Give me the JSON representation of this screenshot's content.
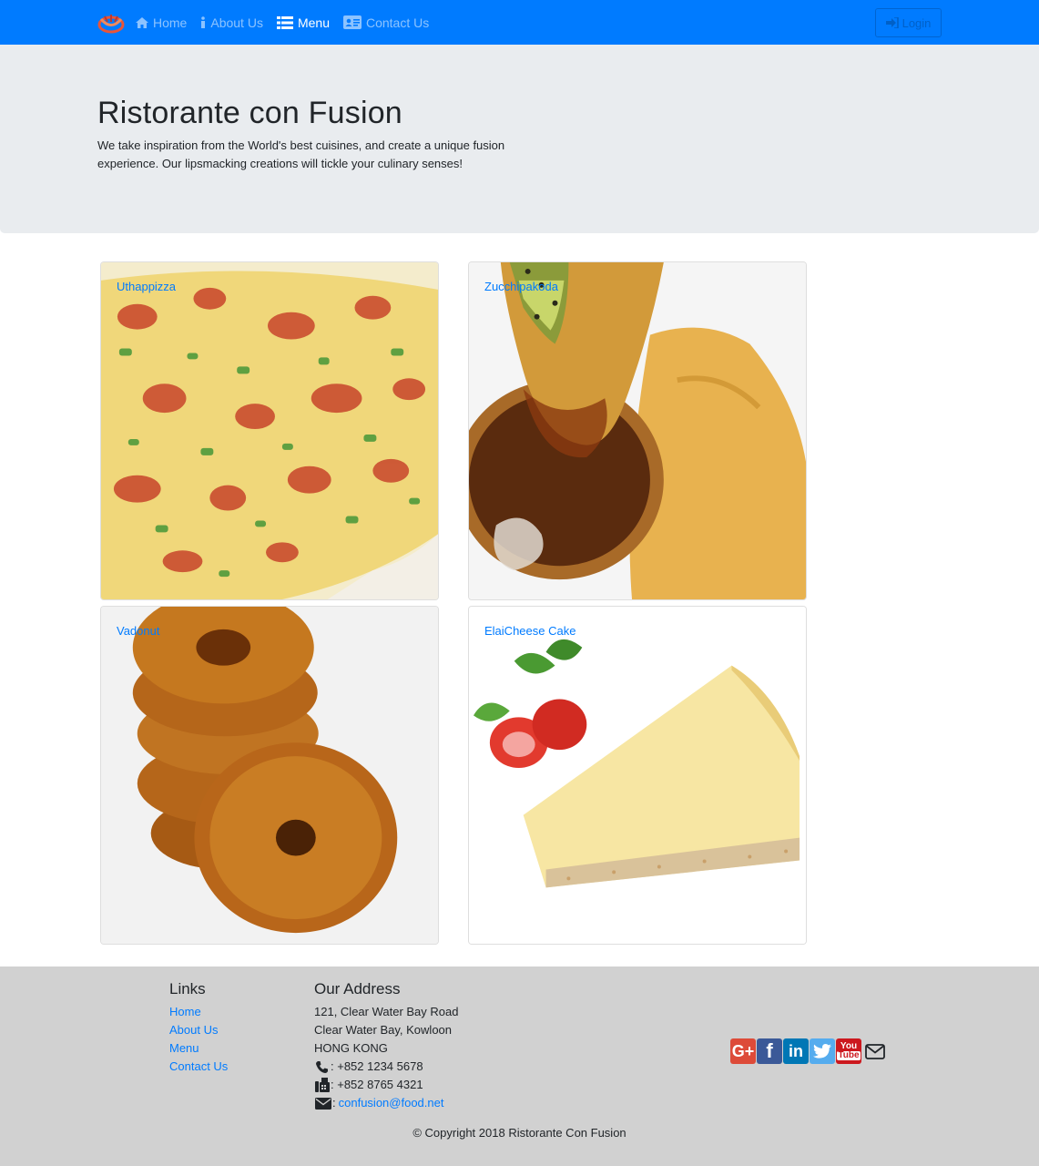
{
  "navbar": {
    "brand_icon": "restaurant-logo-icon",
    "items": [
      {
        "label": "Home",
        "icon": "home-icon"
      },
      {
        "label": "About Us",
        "icon": "info-icon"
      },
      {
        "label": "Menu",
        "icon": "list-icon",
        "active": true
      },
      {
        "label": "Contact Us",
        "icon": "address-card-icon"
      }
    ],
    "login_label": "Login",
    "login_icon": "sign-in-icon",
    "color": "#007bff"
  },
  "jumbotron": {
    "title": "Ristorante con Fusion",
    "description": "We take inspiration from the World's best cuisines, and create a unique fusion experience. Our lipsmacking creations will tickle your culinary senses!"
  },
  "menu": {
    "dishes": [
      {
        "name": "Uthappizza"
      },
      {
        "name": "Zucchipakoda"
      },
      {
        "name": "Vadonut"
      },
      {
        "name": "ElaiCheese Cake"
      }
    ]
  },
  "footer": {
    "links_heading": "Links",
    "links": [
      "Home",
      "About Us",
      "Menu",
      "Contact Us"
    ],
    "address_heading": "Our Address",
    "address_lines": [
      "121, Clear Water Bay Road",
      "Clear Water Bay, Kowloon",
      "HONG KONG"
    ],
    "phone": ": +852 1234 5678",
    "fax": ": +852 8765 4321",
    "email_prefix": ":",
    "email": "confusion@food.net",
    "social": [
      {
        "name": "google-plus-icon",
        "color": "#dd4b39"
      },
      {
        "name": "facebook-icon",
        "color": "#3b5998"
      },
      {
        "name": "linkedin-icon",
        "color": "#0077b5"
      },
      {
        "name": "twitter-icon",
        "color": "#55acee"
      },
      {
        "name": "youtube-icon",
        "color": "#cc181e"
      },
      {
        "name": "envelope-icon",
        "color": "#212529"
      }
    ],
    "copyright": "© Copyright 2018 Ristorante Con Fusion"
  }
}
